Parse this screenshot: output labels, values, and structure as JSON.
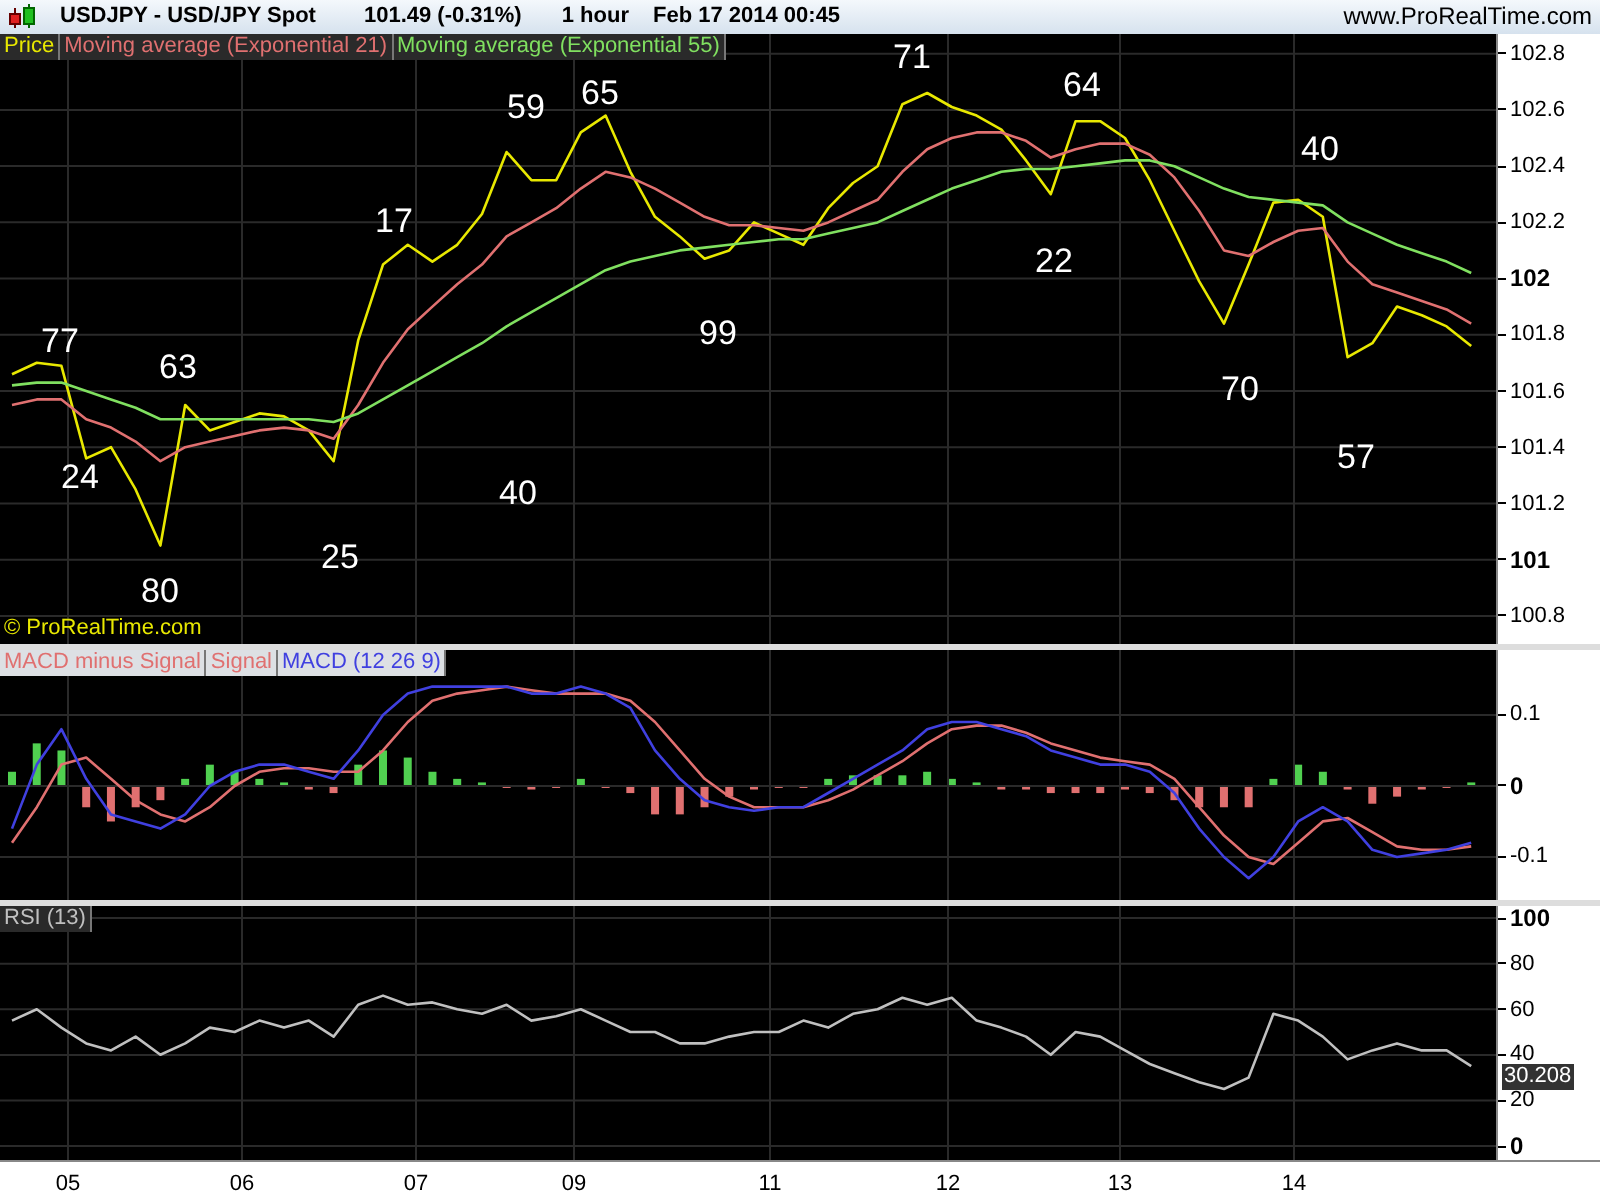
{
  "header": {
    "symbol": "USDJPY - USD/JPY Spot",
    "price": "101.49 (-0.31%)",
    "interval": "1 hour",
    "datetime": "Feb 17 2014 00:45",
    "website": "www.ProRealTime.com"
  },
  "price_panel": {
    "chart_data": {
      "type": "line",
      "grid": true,
      "ylim": [
        100.7,
        102.87
      ],
      "yticks": [
        102.8,
        102.6,
        102.4,
        102.2,
        102,
        101.8,
        101.6,
        101.4,
        101.2,
        101,
        100.8
      ],
      "series": [
        {
          "name": "Price",
          "color": "#e8e800",
          "values": [
            101.66,
            101.7,
            101.69,
            101.36,
            101.4,
            101.25,
            101.05,
            101.55,
            101.46,
            101.49,
            101.52,
            101.51,
            101.46,
            101.35,
            101.78,
            102.05,
            102.12,
            102.06,
            102.12,
            102.23,
            102.45,
            102.35,
            102.35,
            102.52,
            102.58,
            102.38,
            102.22,
            102.15,
            102.07,
            102.1,
            102.2,
            102.16,
            102.12,
            102.25,
            102.34,
            102.4,
            102.62,
            102.66,
            102.61,
            102.58,
            102.53,
            102.42,
            102.3,
            102.56,
            102.56,
            102.5,
            102.35,
            102.17,
            101.99,
            101.84,
            102.05,
            102.27,
            102.28,
            102.22,
            101.72,
            101.77,
            101.9,
            101.87,
            101.83,
            101.76
          ]
        },
        {
          "name": "Moving average (Exponential 21)",
          "color": "#e07070",
          "values": [
            101.55,
            101.57,
            101.57,
            101.5,
            101.47,
            101.42,
            101.35,
            101.4,
            101.42,
            101.44,
            101.46,
            101.47,
            101.46,
            101.43,
            101.55,
            101.7,
            101.82,
            101.9,
            101.98,
            102.05,
            102.15,
            102.2,
            102.25,
            102.32,
            102.38,
            102.36,
            102.32,
            102.27,
            102.22,
            102.19,
            102.19,
            102.18,
            102.17,
            102.2,
            102.24,
            102.28,
            102.38,
            102.46,
            102.5,
            102.52,
            102.52,
            102.49,
            102.43,
            102.46,
            102.48,
            102.48,
            102.44,
            102.36,
            102.24,
            102.1,
            102.08,
            102.13,
            102.17,
            102.18,
            102.06,
            101.98,
            101.95,
            101.92,
            101.89,
            101.84
          ]
        },
        {
          "name": "Moving average (Exponential 55)",
          "color": "#80e060",
          "values": [
            101.62,
            101.63,
            101.63,
            101.6,
            101.57,
            101.54,
            101.5,
            101.5,
            101.5,
            101.5,
            101.5,
            101.5,
            101.5,
            101.49,
            101.52,
            101.57,
            101.62,
            101.67,
            101.72,
            101.77,
            101.83,
            101.88,
            101.93,
            101.98,
            102.03,
            102.06,
            102.08,
            102.1,
            102.11,
            102.12,
            102.13,
            102.14,
            102.14,
            102.16,
            102.18,
            102.2,
            102.24,
            102.28,
            102.32,
            102.35,
            102.38,
            102.39,
            102.39,
            102.4,
            102.41,
            102.42,
            102.42,
            102.4,
            102.36,
            102.32,
            102.29,
            102.28,
            102.27,
            102.26,
            102.2,
            102.16,
            102.12,
            102.09,
            102.06,
            102.02
          ]
        }
      ]
    },
    "annotations": [
      "77",
      "63",
      "24",
      "80",
      "25",
      "17",
      "59",
      "65",
      "40",
      "99",
      "71",
      "64",
      "22",
      "70",
      "40",
      "57"
    ],
    "copyright": "© ProRealTime.com"
  },
  "macd_panel": {
    "histogram_legend": {
      "name": "MACD minus Signal",
      "color": "#e07070"
    },
    "chart_data": {
      "type": "line",
      "grid": true,
      "ylim": [
        -0.1606,
        0.1915
      ],
      "yticks": [
        0.1,
        0,
        -0.1
      ],
      "series": [
        {
          "name": "Signal",
          "color": "#e07070",
          "values": [
            -0.08,
            -0.03,
            0.03,
            0.04,
            0.01,
            -0.02,
            -0.04,
            -0.05,
            -0.03,
            0,
            0.02,
            0.025,
            0.025,
            0.02,
            0.02,
            0.05,
            0.09,
            0.12,
            0.13,
            0.135,
            0.14,
            0.135,
            0.13,
            0.13,
            0.13,
            0.12,
            0.09,
            0.05,
            0.01,
            -0.015,
            -0.03,
            -0.03,
            -0.03,
            -0.02,
            -0.005,
            0.015,
            0.035,
            0.06,
            0.08,
            0.085,
            0.085,
            0.075,
            0.06,
            0.05,
            0.04,
            0.035,
            0.03,
            0.01,
            -0.03,
            -0.07,
            -0.1,
            -0.11,
            -0.08,
            -0.05,
            -0.045,
            -0.065,
            -0.085,
            -0.09,
            -0.09,
            -0.085
          ]
        },
        {
          "name": "MACD (12 26 9)",
          "color": "#4040e0",
          "values": [
            -0.06,
            0.03,
            0.08,
            0.01,
            -0.04,
            -0.05,
            -0.06,
            -0.04,
            0,
            0.02,
            0.03,
            0.03,
            0.02,
            0.01,
            0.05,
            0.1,
            0.13,
            0.14,
            0.14,
            0.14,
            0.14,
            0.13,
            0.13,
            0.14,
            0.13,
            0.11,
            0.05,
            0.01,
            -0.02,
            -0.03,
            -0.035,
            -0.03,
            -0.03,
            -0.01,
            0.01,
            0.03,
            0.05,
            0.08,
            0.09,
            0.09,
            0.08,
            0.07,
            0.05,
            0.04,
            0.03,
            0.03,
            0.02,
            -0.01,
            -0.06,
            -0.1,
            -0.13,
            -0.1,
            -0.05,
            -0.03,
            -0.05,
            -0.09,
            -0.1,
            -0.095,
            -0.09,
            -0.08
          ]
        }
      ]
    }
  },
  "rsi_panel": {
    "chart_data": {
      "type": "line",
      "grid": true,
      "ylim": [
        -6.1,
        105.3
      ],
      "yticks": [
        100,
        80,
        60,
        40,
        20,
        0
      ],
      "series": [
        {
          "name": "RSI (13)",
          "color": "#c0c0c0",
          "values": [
            55,
            60,
            52,
            45,
            42,
            48,
            40,
            45,
            52,
            50,
            55,
            52,
            55,
            48,
            62,
            66,
            62,
            63,
            60,
            58,
            62,
            55,
            57,
            60,
            55,
            50,
            50,
            45,
            45,
            48,
            50,
            50,
            55,
            52,
            58,
            60,
            65,
            62,
            65,
            55,
            52,
            48,
            40,
            50,
            48,
            42,
            36,
            32,
            28,
            25,
            30,
            58,
            55,
            48,
            38,
            42,
            45,
            42,
            42,
            35
          ]
        }
      ]
    },
    "current_value": "30.208"
  },
  "x_axis": [
    "05",
    "06",
    "07",
    "09",
    "11",
    "12",
    "13",
    "14"
  ]
}
